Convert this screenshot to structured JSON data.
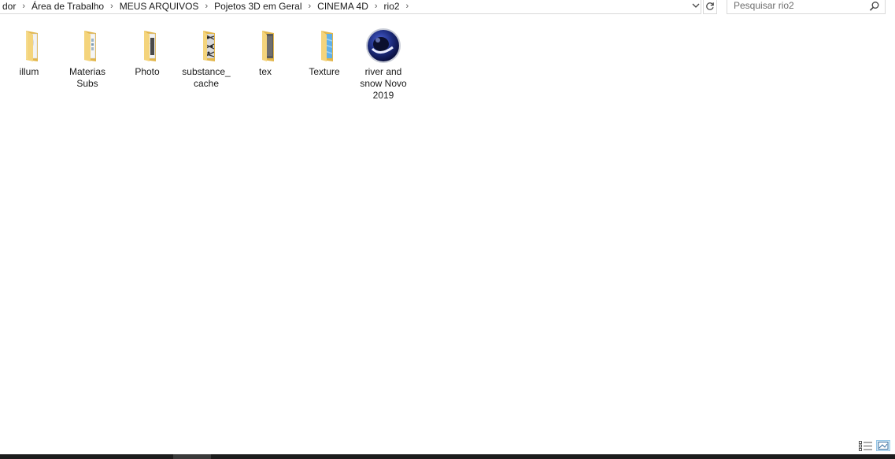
{
  "address": {
    "crumbs": [
      "dor",
      "Área de Trabalho",
      "MEUS ARQUIVOS",
      "Pojetos 3D em Geral",
      "CINEMA 4D",
      "rio2"
    ]
  },
  "search": {
    "placeholder": "Pesquisar rio2"
  },
  "items": [
    {
      "name": "illum",
      "type": "folder"
    },
    {
      "name": "Materias Subs",
      "type": "folder"
    },
    {
      "name": "Photo",
      "type": "folder"
    },
    {
      "name": "substance_ cache",
      "type": "folder"
    },
    {
      "name": "tex",
      "type": "folder"
    },
    {
      "name": "Texture",
      "type": "folder"
    },
    {
      "name": "river and snow Novo 2019",
      "type": "cinema4d-file"
    }
  ],
  "colors": {
    "folder": "#f4d47c",
    "folder_dark": "#e2b64a",
    "c4d": "#1b2a7a",
    "accent": "#0078d7"
  }
}
